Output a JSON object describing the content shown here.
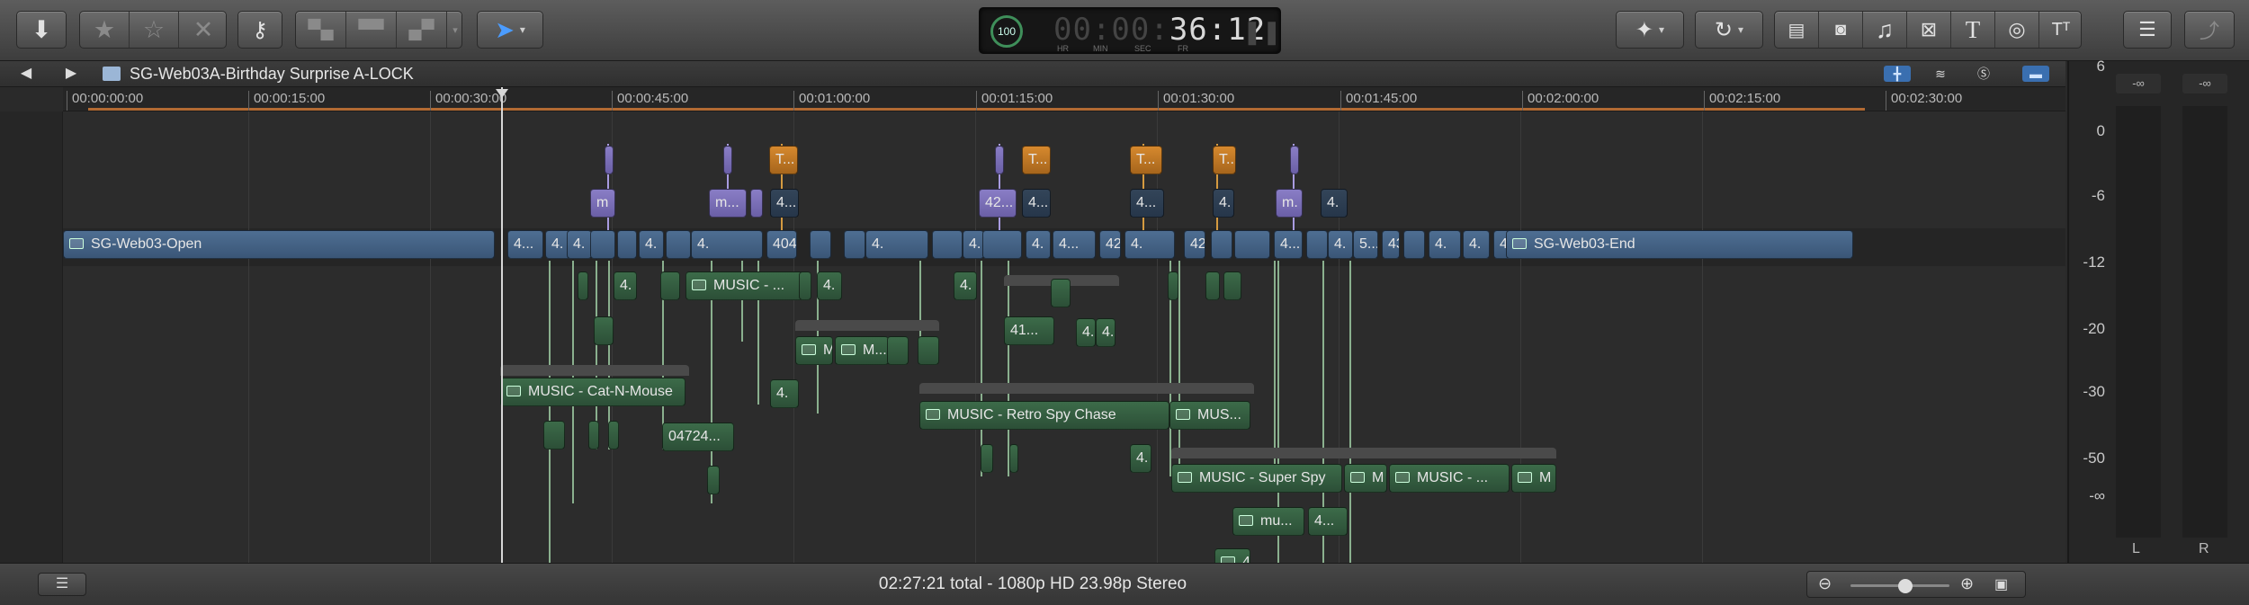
{
  "toolbar": {
    "import_icon": "download-arrow-icon",
    "favorite_icon": "star-icon",
    "unrate_icon": "star-outline-icon",
    "reject_icon": "x-icon",
    "keyword_icon": "key-icon",
    "tool_icon": "cursor-arrow-icon",
    "enhance_icon": "magic-wand-icon",
    "retime_icon": "speedometer-icon",
    "right_icons": [
      "film-icon",
      "camera-icon",
      "music-note-icon",
      "transition-icon",
      "title-T-icon",
      "globe-icon",
      "text-generator-icon"
    ],
    "inspector_icon": "sliders-icon",
    "share_icon": "share-icon"
  },
  "timecode": {
    "percent": "100",
    "unit": "%",
    "dim_digits": "00:00:",
    "lit_digits": "36:12",
    "labels": [
      "HR",
      "MIN",
      "SEC",
      "FR"
    ],
    "pause_icon": "pause-icon"
  },
  "timeline": {
    "title": "SG-Web03A-Birthday Surprise A-LOCK",
    "back_icon": "triangle-left-icon",
    "forward_icon": "triangle-right-icon",
    "ruler": [
      "00:00:00:00",
      "00:00:15:00",
      "00:00:30:00",
      "00:00:45:00",
      "00:01:00:00",
      "00:01:15:00",
      "00:01:30:00",
      "00:01:45:00",
      "00:02:00:00",
      "00:02:15:00",
      "00:02:30:00"
    ],
    "primary": [
      {
        "label": "SG-Web03-Open"
      },
      {
        "label": "4..."
      },
      {
        "label": "4."
      },
      {
        "label": "4."
      },
      {
        "label": "4."
      },
      {
        "label": "4."
      },
      {
        "label": "404-2 ..."
      },
      {
        "label": "4."
      },
      {
        "label": "4."
      },
      {
        "label": "4."
      },
      {
        "label": "4..."
      },
      {
        "label": "42..."
      },
      {
        "label": "4."
      },
      {
        "label": "42..."
      },
      {
        "label": "4..."
      },
      {
        "label": "4."
      },
      {
        "label": "5..."
      },
      {
        "label": "43..."
      },
      {
        "label": "4."
      },
      {
        "label": "4."
      },
      {
        "label": "4."
      },
      {
        "label": "4..."
      },
      {
        "label": "SG-Web03-End"
      }
    ],
    "titles": [
      "T...",
      "T...",
      "T...",
      "T..."
    ],
    "video_connected": [
      "m",
      "m...",
      "42...",
      "m."
    ],
    "dark_connected": [
      "4...",
      "4...",
      "4...",
      "4.",
      "4."
    ],
    "audio": [
      {
        "label": "4."
      },
      {
        "label": "MUSIC - ..."
      },
      {
        "label": "4."
      },
      {
        "label": "4."
      },
      {
        "label": "4."
      },
      {
        "label": "4."
      },
      {
        "label": "41..."
      },
      {
        "label": "M"
      },
      {
        "label": "M..."
      },
      {
        "label": "MUSIC - Cat-N-Mouse"
      },
      {
        "label": "4."
      },
      {
        "label": "04724..."
      },
      {
        "label": "MUSIC - Retro Spy Chase"
      },
      {
        "label": "MUS..."
      },
      {
        "label": "4."
      },
      {
        "label": "MUSIC - Super Spy"
      },
      {
        "label": "M"
      },
      {
        "label": "MUSIC - ..."
      },
      {
        "label": "M"
      },
      {
        "label": "mu..."
      },
      {
        "label": "4..."
      },
      {
        "label": "4..."
      }
    ]
  },
  "meters": {
    "peak_l": "-∞",
    "peak_r": "-∞",
    "scale": [
      "6",
      "0",
      "-6",
      "-12",
      "-20",
      "-30",
      "-50",
      "-∞"
    ],
    "channels": [
      "L",
      "R"
    ]
  },
  "status": {
    "text": "02:27:21 total - 1080p HD 23.98p Stereo",
    "list_icon": "list-icon",
    "zoom_out_icon": "zoom-out-icon",
    "zoom_in_icon": "zoom-in-icon",
    "clip_appearance_icon": "filmstrip-icon",
    "zoom_level": 0.55
  }
}
